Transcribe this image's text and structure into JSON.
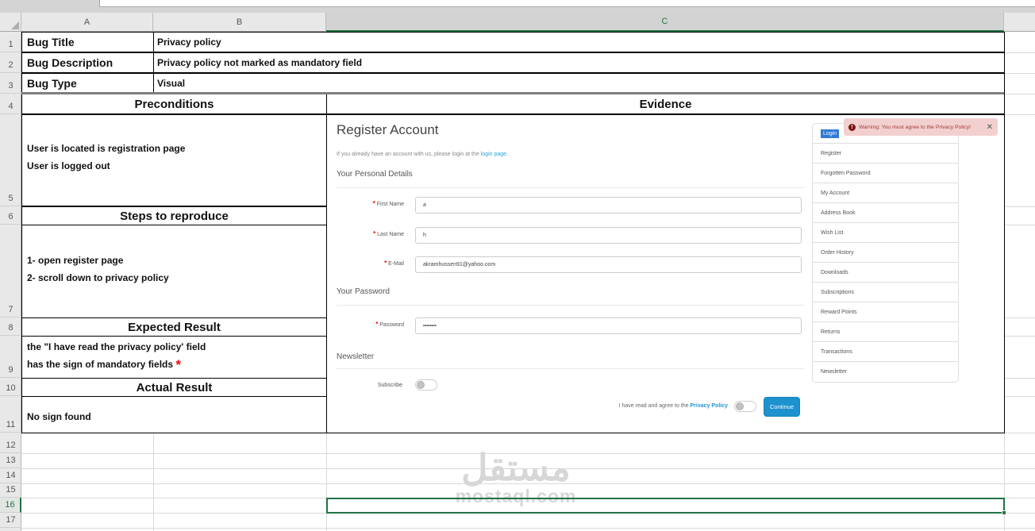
{
  "sheet": {
    "column_headers": [
      "A",
      "B",
      "C"
    ],
    "row_numbers": [
      "1",
      "2",
      "3",
      "4",
      "5",
      "6",
      "7",
      "8",
      "9",
      "10",
      "11",
      "12",
      "13",
      "14",
      "15",
      "16",
      "17"
    ],
    "selected_cell": {
      "column": "C",
      "row": "16"
    },
    "bug_table": {
      "bug_title_label": "Bug Title",
      "bug_title_value": "Privacy policy",
      "bug_description_label": "Bug Description",
      "bug_description_value": "Privacy policy not marked as mandatory field",
      "bug_type_label": "Bug Type",
      "bug_type_value": "Visual",
      "preconditions_header": "Preconditions",
      "evidence_header": "Evidence",
      "preconditions_line1": "User is located is registration page",
      "preconditions_line2": "User is logged out",
      "steps_header": "Steps to reproduce",
      "steps_line1": "1- open register page",
      "steps_line2": "2- scroll down to privacy policy",
      "expected_header": "Expected Result",
      "expected_line1": "the \"I have read the privacy policy' field",
      "expected_line2": "has the sign of mandatory fields",
      "mandatory_sign": "*",
      "actual_header": "Actual Result",
      "actual_line1": "No sign found"
    }
  },
  "evidence": {
    "register": {
      "title": "Register Account",
      "subtext": "If you already have an account with us, please login at the ",
      "login_link": "login page.",
      "section_personal": "Your Personal Details",
      "section_password": "Your Password",
      "section_newsletter": "Newsletter",
      "required_mark": "*",
      "first_name_label": "First Name",
      "first_name_value": "a",
      "last_name_label": "Last Name",
      "last_name_value": "h",
      "email_label": "E-Mail",
      "email_value": "akramhussen91@yahoo.com",
      "password_label": "Password",
      "password_value": "••••••••",
      "subscribe_label": "Subscribe",
      "agree_text": "I have read and agree to the ",
      "privacy_policy_link": "Privacy Policy",
      "continue_button": "Continue"
    },
    "sidebar": {
      "items": [
        "Login",
        "Register",
        "Forgotten Password",
        "My Account",
        "Address Book",
        "Wish List",
        "Order History",
        "Downloads",
        "Subscriptions",
        "Reward Points",
        "Returns",
        "Transactions",
        "Newsletter"
      ]
    },
    "warning": {
      "icon": "!",
      "text": "Warning: You must agree to the Privacy Policy!",
      "close": "✕"
    }
  },
  "watermark": {
    "arabic": "مستقل",
    "latin": "mostaql.com"
  },
  "colors": {
    "excel_green": "#217346",
    "selection_border": "#217346",
    "link_blue": "#2ba3d2",
    "privacy_link_blue": "#2196d3",
    "continue_button_blue": "#1e91cf",
    "warning_bg": "#f2d0d0",
    "warning_text": "#a23b36",
    "login_highlight": "#2f79d6",
    "mandatory_red": "#f00000"
  }
}
